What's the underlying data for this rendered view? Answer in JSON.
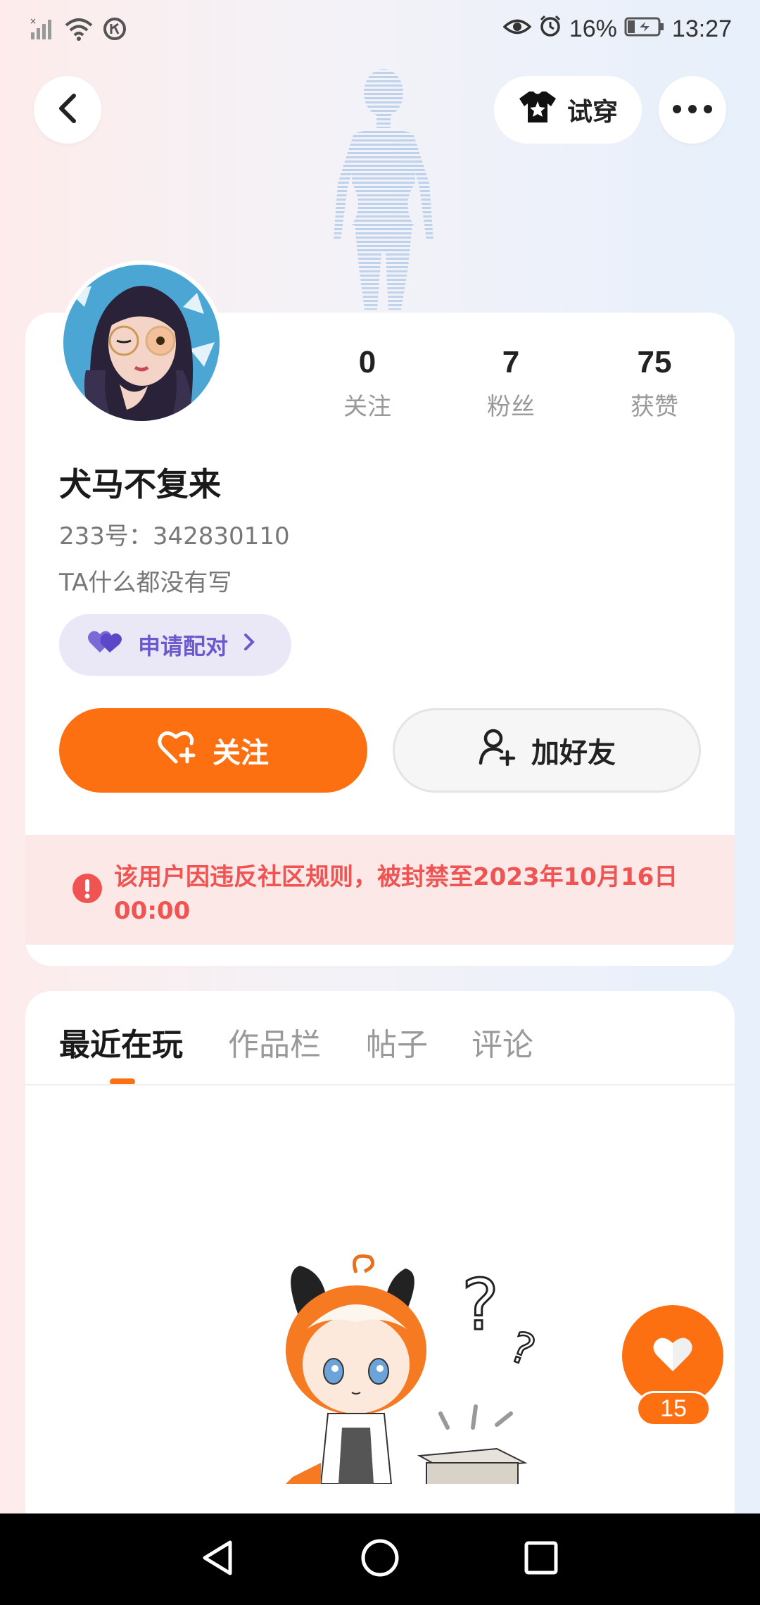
{
  "status_bar": {
    "battery": "16%",
    "time": "13:27"
  },
  "header": {
    "tryon_label": "试穿"
  },
  "profile": {
    "stats": [
      {
        "value": "0",
        "label": "关注"
      },
      {
        "value": "7",
        "label": "粉丝"
      },
      {
        "value": "75",
        "label": "获赞"
      }
    ],
    "nickname": "犬马不复来",
    "uid": "233号：342830110",
    "bio": "TA什么都没有写",
    "pair_label": "申请配对",
    "follow_label": "关注",
    "add_friend_label": "加好友",
    "ban_notice": "该用户因违反社区规则，被封禁至2023年10月16日 00:00"
  },
  "tabs": [
    "最近在玩",
    "作品栏",
    "帖子",
    "评论"
  ],
  "active_tab": 0,
  "like": {
    "count": "15"
  },
  "colors": {
    "accent": "#fd7012",
    "pair": "#6a5acd",
    "ban": "#ef5452"
  }
}
